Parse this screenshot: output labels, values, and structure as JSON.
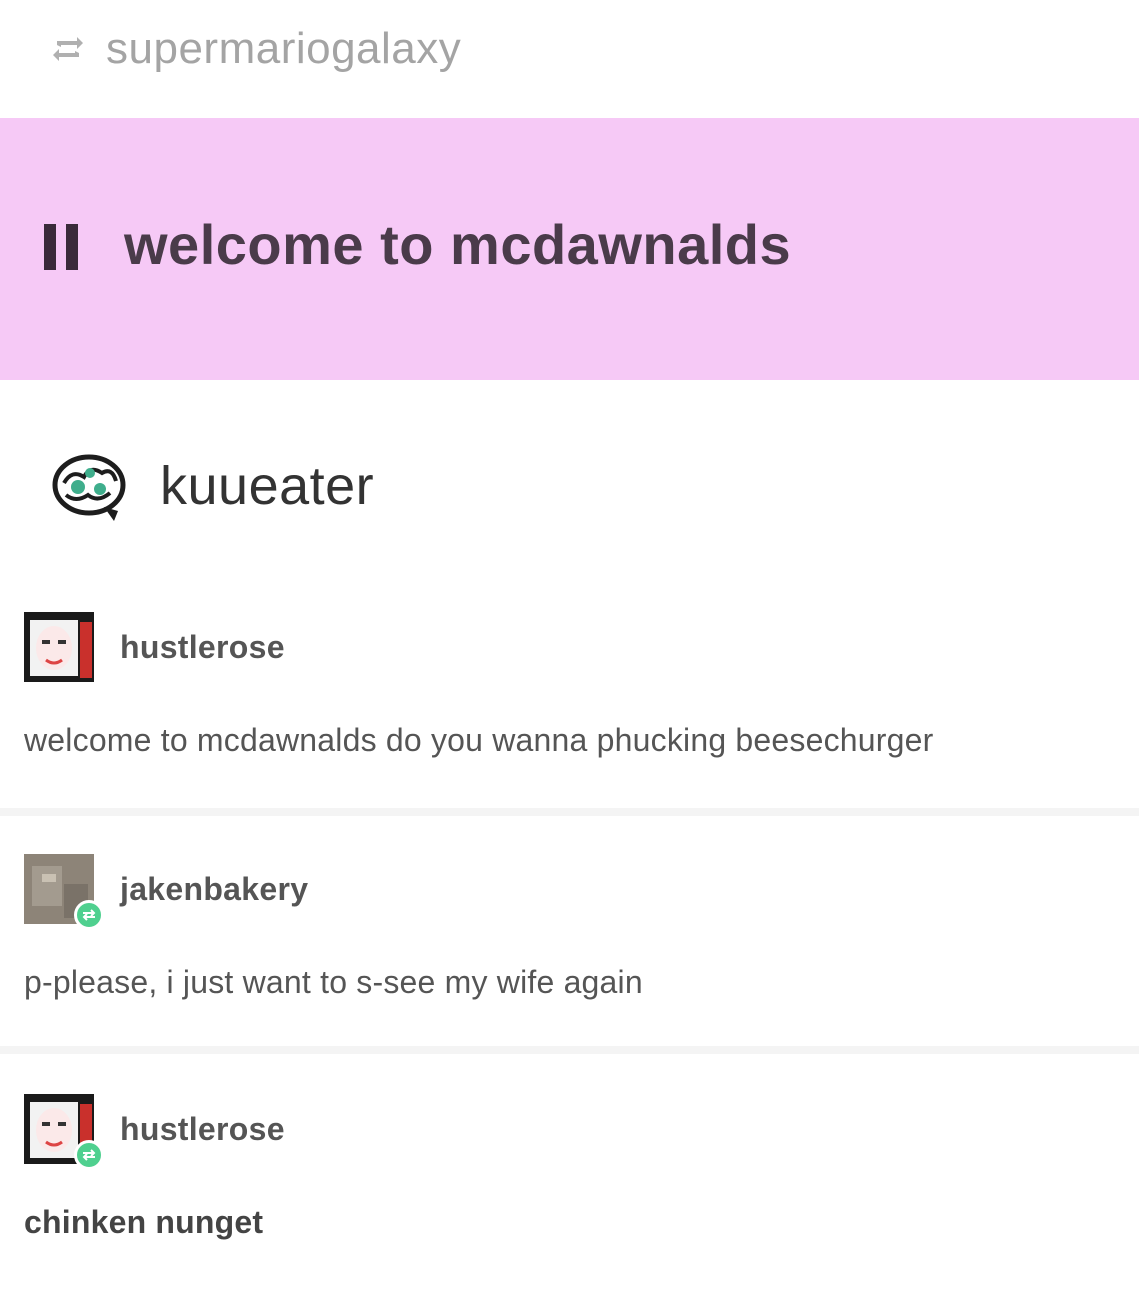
{
  "reblog": {
    "icon": "reblog-icon",
    "username": "supermariogalaxy"
  },
  "banner": {
    "background": "#f6c9f6",
    "icon": "pause-icon",
    "title": "welcome to mcdawnalds"
  },
  "op": {
    "avatar_icon": "brain-avatar",
    "username": "kuueater"
  },
  "posts": [
    {
      "username": "hustlerose",
      "avatar": "user-avatar",
      "badge": false,
      "text": "welcome to mcdawnalds do you wanna phucking beesechurger"
    },
    {
      "username": "jakenbakery",
      "avatar": "user-avatar",
      "badge": true,
      "text": "p-please, i just want to s-see my wife again"
    },
    {
      "username": "hustlerose",
      "avatar": "user-avatar",
      "badge": true,
      "text": "chinken nunget"
    }
  ],
  "colors": {
    "badge": "#4fd08f",
    "banner": "#f6c9f6"
  }
}
